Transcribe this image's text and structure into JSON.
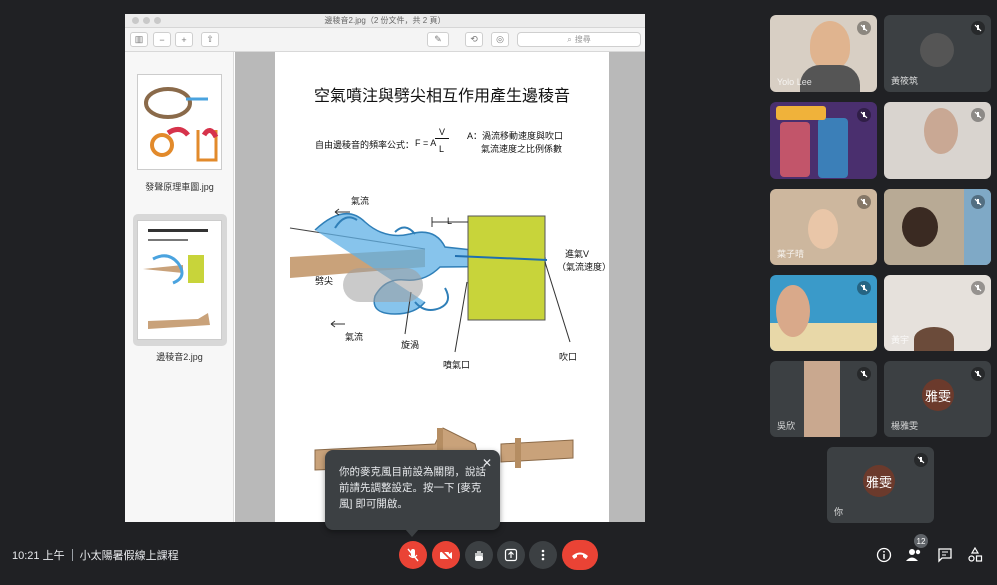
{
  "viewer": {
    "window_title": "邊稜音2.jpg（2 份文件，共 2 頁）",
    "search_placeholder": "搜尋",
    "thumbnails": [
      {
        "label": "發聲原理車圖.jpg"
      },
      {
        "label": "邊稜音2.jpg"
      }
    ],
    "page": {
      "title": "空氣噴注與劈尖相互作用產生邊稜音",
      "formula_label": "自由邊稜音的頻率公式：",
      "formula_f": "F = A",
      "formula_num": "V",
      "formula_den": "L",
      "coef_line1": "A：渦流移動速度與吹口",
      "coef_line2": "氣流速度之比例係數",
      "label_airflow_top": "氣流",
      "label_L": "L",
      "label_jet": "進氣V",
      "label_jet_speed": "（氣流速度）",
      "label_wedge": "劈尖",
      "label_airflow_bottom": "氣流",
      "label_vortex": "旋渦",
      "label_nozzle": "噴氣口",
      "label_mouth": "吹口"
    }
  },
  "participants": [
    {
      "name": "Yolo Lee"
    },
    {
      "name": "黃筱筑"
    },
    {
      "name": ""
    },
    {
      "name": ""
    },
    {
      "name": "葉子晴"
    },
    {
      "name": ""
    },
    {
      "name": ""
    },
    {
      "name": "黃宇"
    },
    {
      "name": "吳欣"
    },
    {
      "name": "楊雅雯",
      "initials": "雅雯"
    }
  ],
  "self_tile": {
    "name": "你",
    "initials": "雅雯"
  },
  "tooltip": {
    "text": "你的麥克風目前設為關閉，說話前請先調整設定。按一下 [麥克風] 即可開啟。"
  },
  "bottom_bar": {
    "time": "10:21 上午",
    "meeting_title": "小太陽暑假線上課程",
    "participant_count": "12"
  },
  "colors": {
    "background": "#202124",
    "tile": "#3c4043",
    "danger": "#ea4335",
    "accent_yellow": "#c8d43a",
    "water_blue": "#4aa3df",
    "wood": "#c9a27a"
  }
}
